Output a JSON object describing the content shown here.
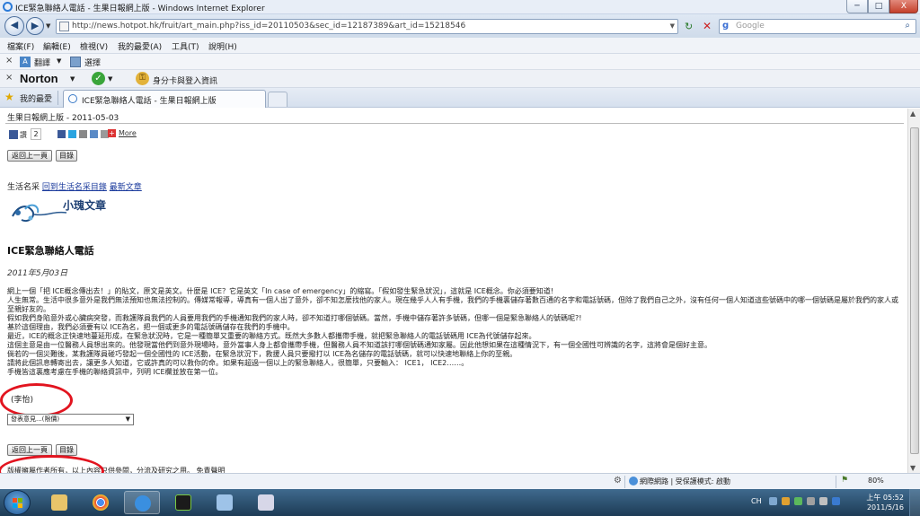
{
  "window": {
    "title": "ICE緊急聯絡人電話 - 生果日報網上版 - Windows Internet Explorer",
    "min": "─",
    "max": "□",
    "close": "X"
  },
  "address_bar": {
    "url": "http://news.hotpot.hk/fruit/art_main.php?iss_id=20110503&sec_id=12187389&art_id=15218546"
  },
  "search": {
    "engine": "g",
    "placeholder": "Google"
  },
  "menu": [
    "檔案(F)",
    "編輯(E)",
    "檢視(V)",
    "我的最愛(A)",
    "工具(T)",
    "說明(H)"
  ],
  "toolbar1": {
    "translate": "翻譯",
    "select": "選擇"
  },
  "toolbar2": {
    "brand": "Norton",
    "identity": "身分卡與登入資訊"
  },
  "favorites": {
    "label": "我的最愛"
  },
  "tab": {
    "label": "ICE緊急聯絡人電話 - 生果日報網上版"
  },
  "page": {
    "section": "生果日報網上版 - 2011-05-03",
    "share": {
      "like": "讚",
      "count": "2",
      "more": "More"
    },
    "buttons": {
      "back": "返回上一頁",
      "toc": "目錄"
    },
    "category": {
      "label": "生活名采",
      "back_link": "回到生活名采目錄",
      "latest": "最新文章"
    },
    "logo_text": "小瑰文章",
    "title": "ICE緊急聯絡人電話",
    "date": "2011年5月03日",
    "paragraphs": [
      "網上一個「把 ICE概念傳出去！」的貼文，原文是英文。什麼是 ICE？它是英文「In case of emergency」的縮寫。「假如發生緊急狀況」，這就是 ICE概念。你必須要知道!",
      "人生無常。生活中很多意外是我們無法預知也無法控制的。傳媒常報導，導真有一個人出了意外，卻不知怎麼找他的家人。現在幾乎人人有手機，我們的手機裏儲存著數百通的名字和電話號碼，但除了我們自己之外，沒有任何一個人知道這些號碼中的哪一個號碼是屬於我們的家人或至親好友的。",
      "假如我們身陷意外或心臟病突發，而救護隊員我們的人員要用我們的手機通知我們的家人時，卻不知道打哪個號碼。當然，手機中儲存著許多號碼，但哪一個是緊急聯絡人的號碼呢?!",
      "基於這個理由，我們必須要有以 ICE為名，把一個或更多的電話號碼儲存在我們的手機中。",
      "最近，ICE的概念正快速地蔓延形成，在緊急狀況時，它是一種簡單又重要的聯絡方式。既然大多數人都攜帶手機，就把緊急聯絡人的電話號碼用 ICE為代號儲存起來。",
      "這個主意是由一位醫務人員想出來的。他發現當他們到意外現場時，意外當事人身上都會攜帶手機，但醫務人員不知道該打哪個號碼通知家屬。因此他想如果在這種情況下，有一個全國性可辨識的名字，這將會是個好主意。",
      "倘若的一個災難後，某救護隊員碰巧發起一個全國性的 ICE活動，在緊急狀況下，救援人員只要撥打以 ICE為名儲存的電話號碼，就可以快速地聯絡上你的至親。",
      "請將此個訊息轉寄出去，讓更多人知道，它或許真的可以救你的命。如果有超過一個以上的緊急聯絡人，很簡單，只要輸入： ICE1， ICE2……。",
      "手機皆這裏應考慮在手機的聯絡資訊中，列明 ICE欄並放在第一位。"
    ],
    "author": "(李怡)",
    "select": "發表意見...(限價)",
    "copyright": "版權擁屬作者所有，以上內容只供參閱，分流及研究之用。 免責聲明"
  },
  "statusbar": {
    "zone": "網際網路 | 受保護模式: 啟動",
    "zoom": "80%"
  },
  "taskbar": {
    "ime": "CH",
    "time": "上午 05:52",
    "date": "2011/5/16"
  },
  "colors": {
    "accent": "#1a3a9c",
    "highlight_circle": "#e2141f"
  },
  "icons": [
    "ie-icon",
    "back-icon",
    "forward-icon",
    "refresh-icon",
    "stop-icon",
    "search-icon",
    "star-icon",
    "norton-check-icon",
    "lock-icon",
    "globe-icon",
    "start-orb-icon"
  ]
}
